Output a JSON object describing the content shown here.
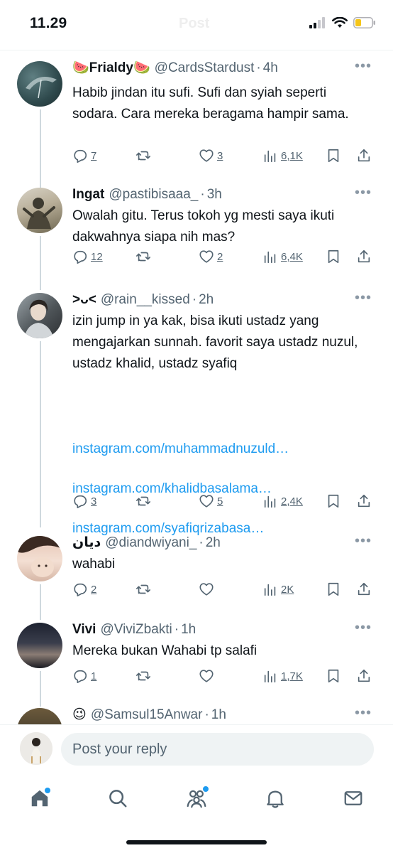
{
  "status_bar": {
    "time": "11.29",
    "title": "Post"
  },
  "tweets": [
    {
      "emoji_left": "🍉",
      "name": "Frialdy",
      "emoji_right": "🍉",
      "handle": "@CardsStardust",
      "time": "4h",
      "text": "Habib jindan itu sufi. Sufi dan syiah seperti sodara. Cara mereka beragama hampir sama.",
      "replies": "7",
      "retweets": "",
      "likes": "3",
      "views": "6,1K"
    },
    {
      "name": "Ingat",
      "handle": "@pastibisaaa_",
      "time": "3h",
      "text": "Owalah gitu. Terus tokoh yg mesti saya ikuti dakwahnya siapa nih mas?",
      "replies": "12",
      "retweets": "",
      "likes": "2",
      "views": "6,4K"
    },
    {
      "name": "˃ᴗ˂",
      "handle": "@rain__kissed",
      "time": "2h",
      "text": "izin jump in ya kak, bisa ikuti ustadz yang mengajarkan sunnah. favorit saya ustadz nuzul, ustadz khalid, ustadz syafiq",
      "links": [
        "instagram.com/muhammadnuzuld…",
        "instagram.com/khalidbasalama…",
        "instagram.com/syafiqrizabasa…"
      ],
      "replies": "3",
      "retweets": "",
      "likes": "5",
      "views": "2,4K"
    },
    {
      "name": "ديان",
      "handle": "@diandwiyani_",
      "time": "2h",
      "text": "wahabi",
      "replies": "2",
      "retweets": "",
      "likes": "",
      "views": "2K"
    },
    {
      "name": "Vivi",
      "handle": "@ViviZbakti",
      "time": "1h",
      "text": "Mereka bukan Wahabi tp salafi",
      "replies": "1",
      "retweets": "",
      "likes": "",
      "views": "1,7K"
    },
    {
      "name": "😉",
      "handle": "@Samsul15Anwar",
      "time": "1h"
    }
  ],
  "separator": "·",
  "more_glyph": "•••",
  "reply_bar": {
    "placeholder": "Post your reply"
  },
  "icons": {
    "status": [
      "signal-icon",
      "wifi-icon",
      "battery-icon"
    ],
    "actions": [
      "reply-icon",
      "retweet-icon",
      "like-icon",
      "views-icon",
      "bookmark-icon",
      "share-icon"
    ],
    "tabs": [
      "home-icon",
      "search-icon",
      "communities-icon",
      "notifications-icon",
      "messages-icon"
    ]
  },
  "colors": {
    "link": "#1d9bf0",
    "muted": "#536471",
    "thread_line": "#cfd9de",
    "battery": "#f5c518"
  }
}
